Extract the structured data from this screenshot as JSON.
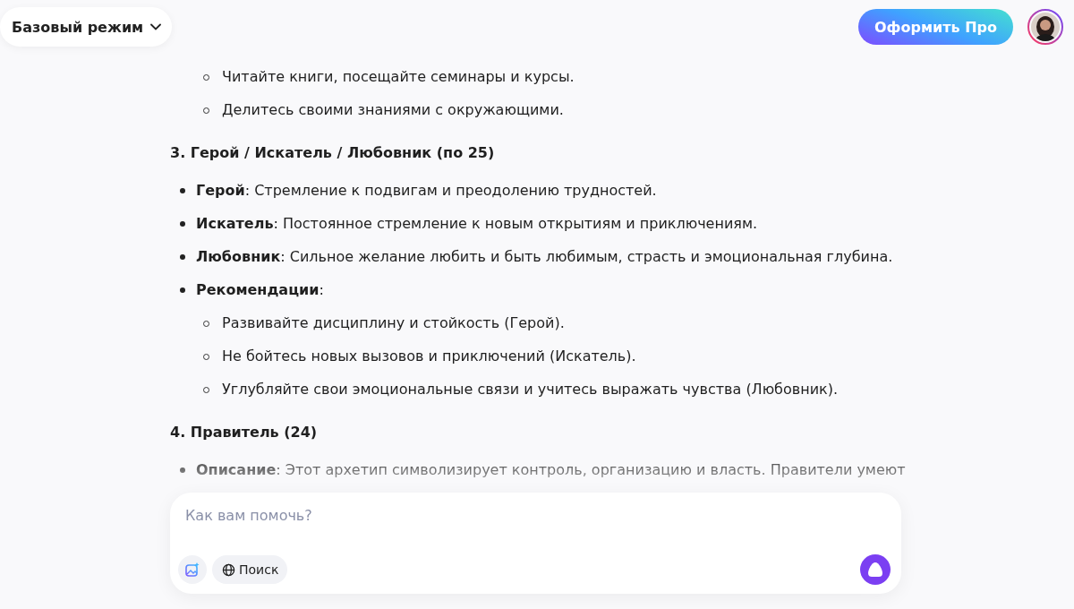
{
  "header": {
    "mode_label": "Базовый режим",
    "pro_button": "Оформить Про"
  },
  "content": [
    {
      "kind": "subitem",
      "text": "Читайте книги, посещайте семинары и курсы."
    },
    {
      "kind": "subitem",
      "text": "Делитесь своими знаниями с окружающими."
    },
    {
      "kind": "heading",
      "text": "3. Герой / Искатель / Любовник (по 25)"
    },
    {
      "kind": "bullet",
      "text": "**Герой**: Стремление к подвигам и преодолению трудностей."
    },
    {
      "kind": "bullet",
      "text": "**Искатель**: Постоянное стремление к новым открытиям и приключениям."
    },
    {
      "kind": "bullet",
      "text": "**Любовник**: Сильное желание любить и быть любимым, страсть и эмоциональная глубина."
    },
    {
      "kind": "bullet",
      "text": "**Рекомендации**:",
      "children": [
        {
          "text": "Развивайте дисциплину и стойкость (Герой)."
        },
        {
          "text": "Не бойтесь новых вызовов и приключений (Искатель)."
        },
        {
          "text": "Углубляйте свои эмоциональные связи и учитесь выражать чувства (Любовник)."
        }
      ]
    },
    {
      "kind": "heading",
      "text": "4. Правитель (24)"
    },
    {
      "kind": "bullet",
      "text": "**Описание**: Этот архетип символизирует контроль, организацию и власть. Правители умеют"
    }
  ],
  "composer": {
    "placeholder": "Как вам помочь?",
    "search_button": "Поиск"
  }
}
